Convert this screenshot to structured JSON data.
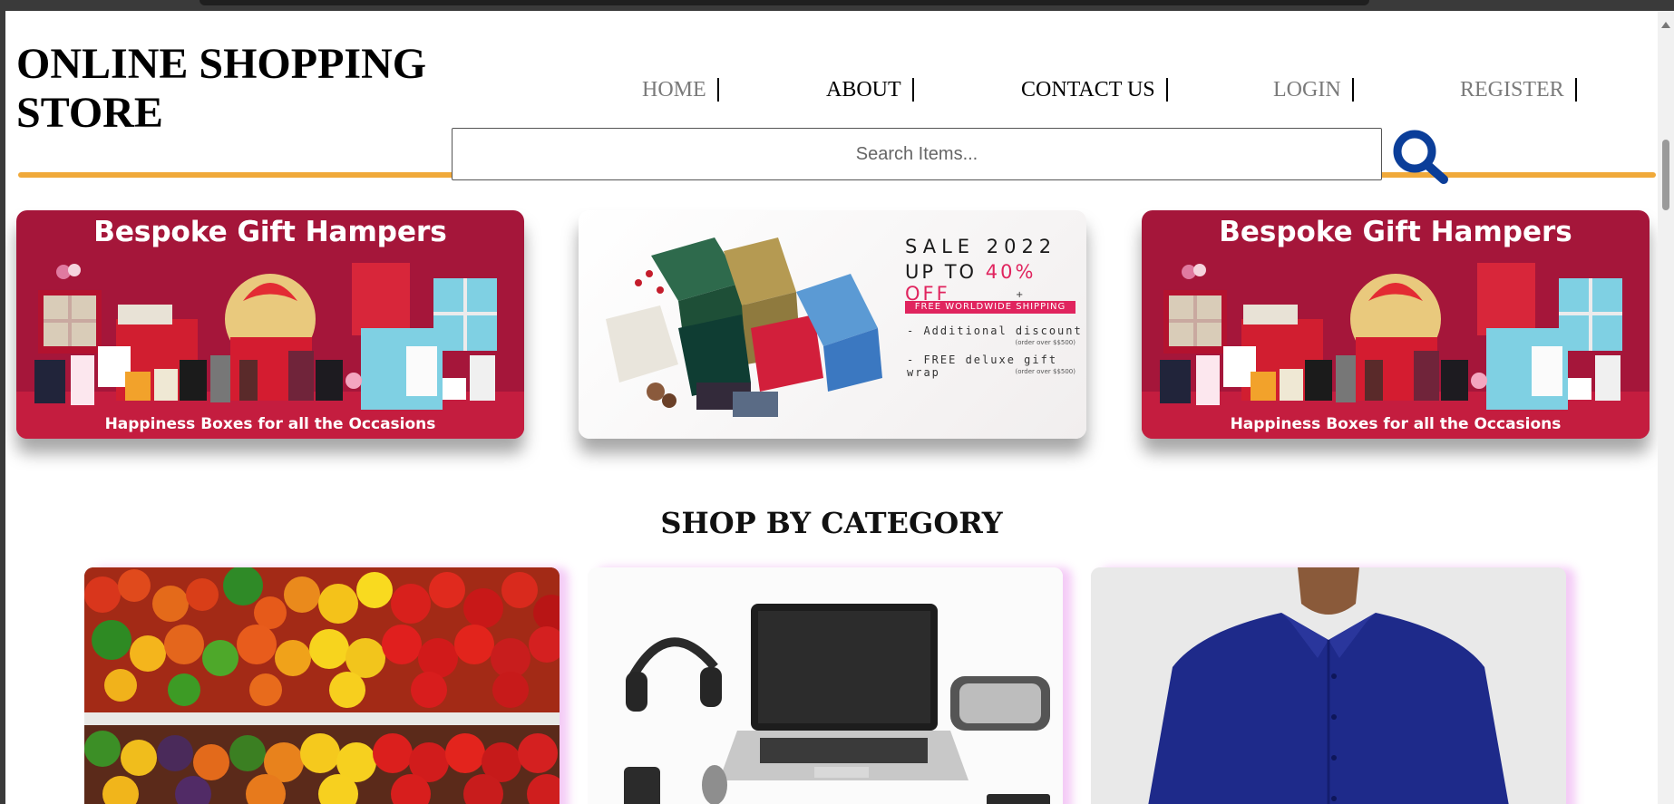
{
  "header": {
    "title": "ONLINE SHOPPING STORE",
    "nav": [
      {
        "label": "HOME"
      },
      {
        "label": "ABOUT"
      },
      {
        "label": "CONTACT US"
      },
      {
        "label": "LOGIN"
      },
      {
        "label": "REGISTER"
      }
    ]
  },
  "search": {
    "placeholder": "Search Items...",
    "icon": "magnifier-icon"
  },
  "banners": [
    {
      "title": "Bespoke Gift Hampers",
      "caption": "Happiness Boxes for all the Occasions"
    },
    {
      "line1": "SALE 2022",
      "line2_prefix": "UP TO ",
      "line2_highlight": "40% OFF",
      "plus": "+",
      "shipping": "FREE WORLDWIDE SHIPPING",
      "detail1": "- Additional discount",
      "detail1_sub": "(order over $$500)",
      "detail2": "- FREE deluxe gift wrap",
      "detail2_sub": "(order over $$500)"
    },
    {
      "title": "Bespoke Gift Hampers",
      "caption": "Happiness Boxes for all the Occasions"
    }
  ],
  "categories": {
    "title": "SHOP BY CATEGORY",
    "items": [
      {
        "name": "vegetables-category-image"
      },
      {
        "name": "electronics-category-image"
      },
      {
        "name": "clothing-category-image"
      }
    ]
  },
  "colors": {
    "accent_line": "#f0a93a",
    "search_icon": "#0b3e99",
    "banner_red": "#a5163a",
    "sale_highlight": "#e0245e"
  }
}
